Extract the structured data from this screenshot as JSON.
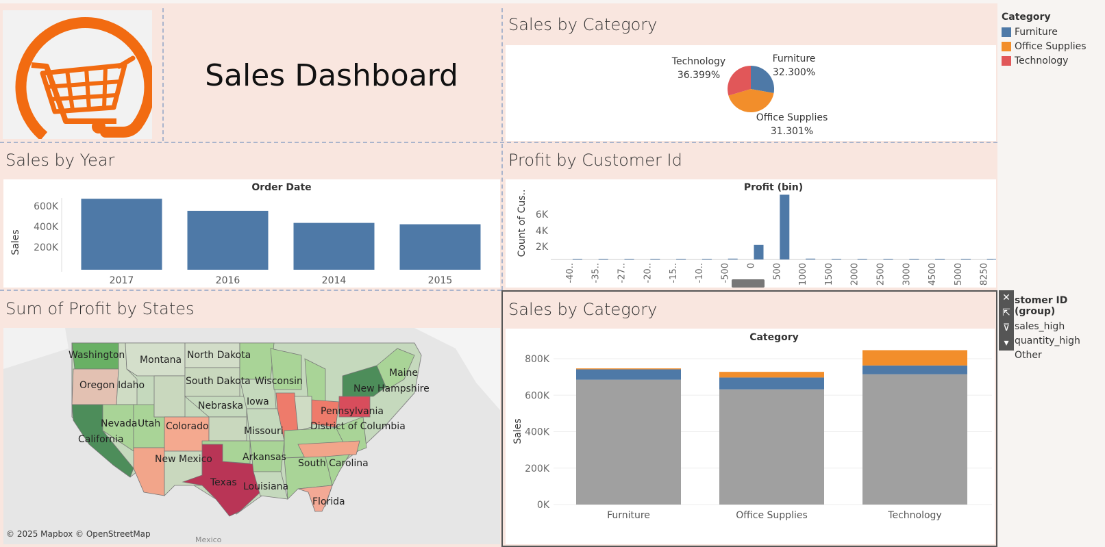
{
  "dashboard": {
    "title": "Sales Dashboard"
  },
  "colors": {
    "pane_bg": "#f9e6df",
    "furniture": "#4e79a7",
    "office_supplies": "#f28e2b",
    "technology": "#e15759",
    "other_group": "#a0a0a0"
  },
  "pie": {
    "title": "Sales by Category",
    "labels": [
      {
        "name": "Technology",
        "pct": "36.399%"
      },
      {
        "name": "Furniture",
        "pct": "32.300%"
      },
      {
        "name": "Office Supplies",
        "pct": "31.301%"
      }
    ]
  },
  "category_legend": {
    "title": "Category",
    "items": [
      "Furniture",
      "Office Supplies",
      "Technology"
    ]
  },
  "year_chart": {
    "title": "Sales by Year",
    "header": "Order Date",
    "ylabel": "Sales",
    "yticks": [
      "600K",
      "400K",
      "200K"
    ]
  },
  "hist_chart": {
    "title": "Profit by Customer Id",
    "header": "Profit (bin)",
    "ylabel": "Count of Cus..",
    "yticks": [
      "6K",
      "4K",
      "2K"
    ],
    "xticks": [
      "-40..",
      "-35..",
      "-27..",
      "-20..",
      "-15..",
      "-10..",
      "-500",
      "0",
      "500",
      "1000",
      "1500",
      "2000",
      "2500",
      "3000",
      "4500",
      "5000",
      "8250"
    ]
  },
  "map": {
    "title": "Sum of Profit by States",
    "attribution": "© 2025 Mapbox © OpenStreetMap",
    "country_label": "Mexico",
    "state_labels": [
      "Washington",
      "Montana",
      "North Dakota",
      "Oregon",
      "Idaho",
      "South Dakota",
      "Wisconsin",
      "Maine",
      "New Hampshire",
      "Nebraska",
      "Iowa",
      "Pennsylvania",
      "Nevada",
      "Utah",
      "Colorado",
      "District of Columbia",
      "California",
      "Missouri",
      "New Mexico",
      "Arkansas",
      "South Carolina",
      "Texas",
      "Louisiana",
      "Florida"
    ]
  },
  "stacked_chart": {
    "title": "Sales by Category",
    "header": "Category",
    "ylabel": "Sales",
    "yticks": [
      "800K",
      "600K",
      "400K",
      "200K",
      "0K"
    ]
  },
  "group_legend": {
    "title": "stomer ID (group)",
    "items": [
      "sales_high",
      "quantity_high",
      "Other"
    ]
  },
  "chart_data": [
    {
      "type": "pie",
      "title": "Sales by Category",
      "categories": [
        "Furniture",
        "Office Supplies",
        "Technology"
      ],
      "values": [
        32.3,
        31.301,
        36.399
      ],
      "unit": "%"
    },
    {
      "type": "bar",
      "title": "Sales by Year",
      "xlabel": "Order Date",
      "ylabel": "Sales",
      "categories": [
        "2017",
        "2016",
        "2014",
        "2015"
      ],
      "values": [
        733000,
        609000,
        484000,
        470000
      ],
      "ylim": [
        0,
        750000
      ]
    },
    {
      "type": "bar",
      "title": "Profit by Customer Id",
      "xlabel": "Profit (bin)",
      "ylabel": "Count of Cus..",
      "categories": [
        "-40..",
        "-35..",
        "-27..",
        "-20..",
        "-15..",
        "-10..",
        "-500",
        "0",
        "500",
        "1000",
        "1500",
        "2000",
        "2500",
        "3000",
        "4500",
        "5000",
        "8250"
      ],
      "values": [
        1,
        1,
        1,
        1,
        1,
        1,
        100,
        1750,
        7800,
        100,
        40,
        10,
        5,
        3,
        2,
        1,
        1
      ],
      "ylim": [
        0,
        8000
      ]
    },
    {
      "type": "bar",
      "stacked": true,
      "title": "Sales by Category",
      "xlabel": "Category",
      "ylabel": "Sales",
      "categories": [
        "Furniture",
        "Office Supplies",
        "Technology"
      ],
      "series": [
        {
          "name": "Other",
          "values": [
            685000,
            632000,
            715000
          ]
        },
        {
          "name": "sales_high",
          "values": [
            57000,
            65000,
            48000
          ]
        },
        {
          "name": "quantity_high",
          "values": [
            5000,
            31000,
            84000
          ]
        }
      ],
      "ylim": [
        0,
        850000
      ]
    }
  ]
}
